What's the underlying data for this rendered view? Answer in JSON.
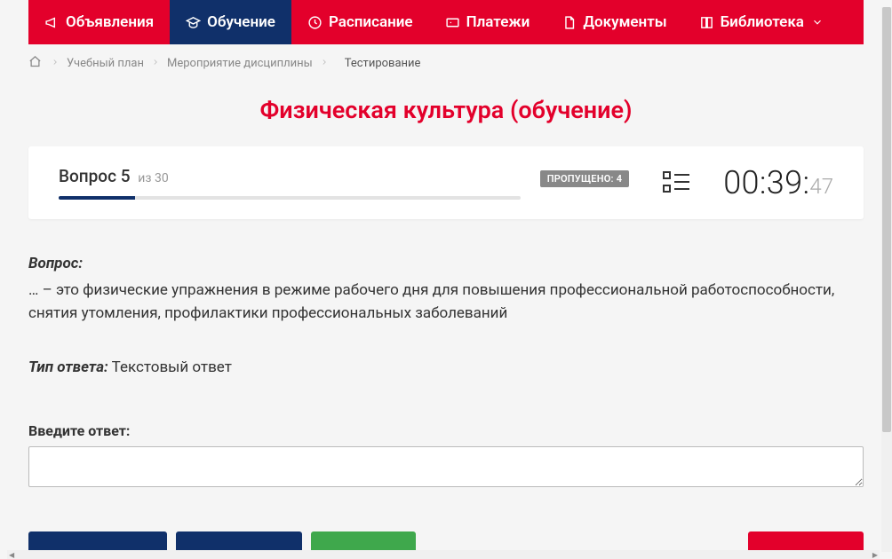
{
  "nav": [
    {
      "icon": "megaphone",
      "label": "Объявления",
      "name": "nav-announcements"
    },
    {
      "icon": "grad-cap",
      "label": "Обучение",
      "name": "nav-learning",
      "active": true
    },
    {
      "icon": "clock",
      "label": "Расписание",
      "name": "nav-schedule"
    },
    {
      "icon": "card",
      "label": "Платежи",
      "name": "nav-payments"
    },
    {
      "icon": "doc",
      "label": "Документы",
      "name": "nav-documents"
    },
    {
      "icon": "book",
      "label": "Библиотека",
      "name": "nav-library",
      "caret": true
    }
  ],
  "breadcrumb": {
    "items": [
      {
        "label": "Учебный план"
      },
      {
        "label": "Мероприятие дисциплины"
      }
    ],
    "current": "Тестирование"
  },
  "page_title": "Физическая культура (обучение)",
  "status": {
    "question_word": "Вопрос",
    "question_num": "5",
    "of_word": "из",
    "total": "30",
    "skipped_label": "ПРОПУЩЕНО:",
    "skipped_count": "4",
    "progress_pct": 16.6,
    "timer_main": "00:39:",
    "timer_sec": "47"
  },
  "question": {
    "header": "Вопрос:",
    "text": "… – это физические упражнения в режиме рабочего дня для повышения профессиональной работоспособности, снятия утомления, профилактики профессиональных заболеваний"
  },
  "answer_type": {
    "label": "Тип ответа:",
    "value": "Текстовый ответ"
  },
  "input": {
    "label": "Введите ответ:",
    "value": ""
  },
  "buttons": {
    "b1": "",
    "b2": "",
    "b3": "",
    "b4": ""
  }
}
